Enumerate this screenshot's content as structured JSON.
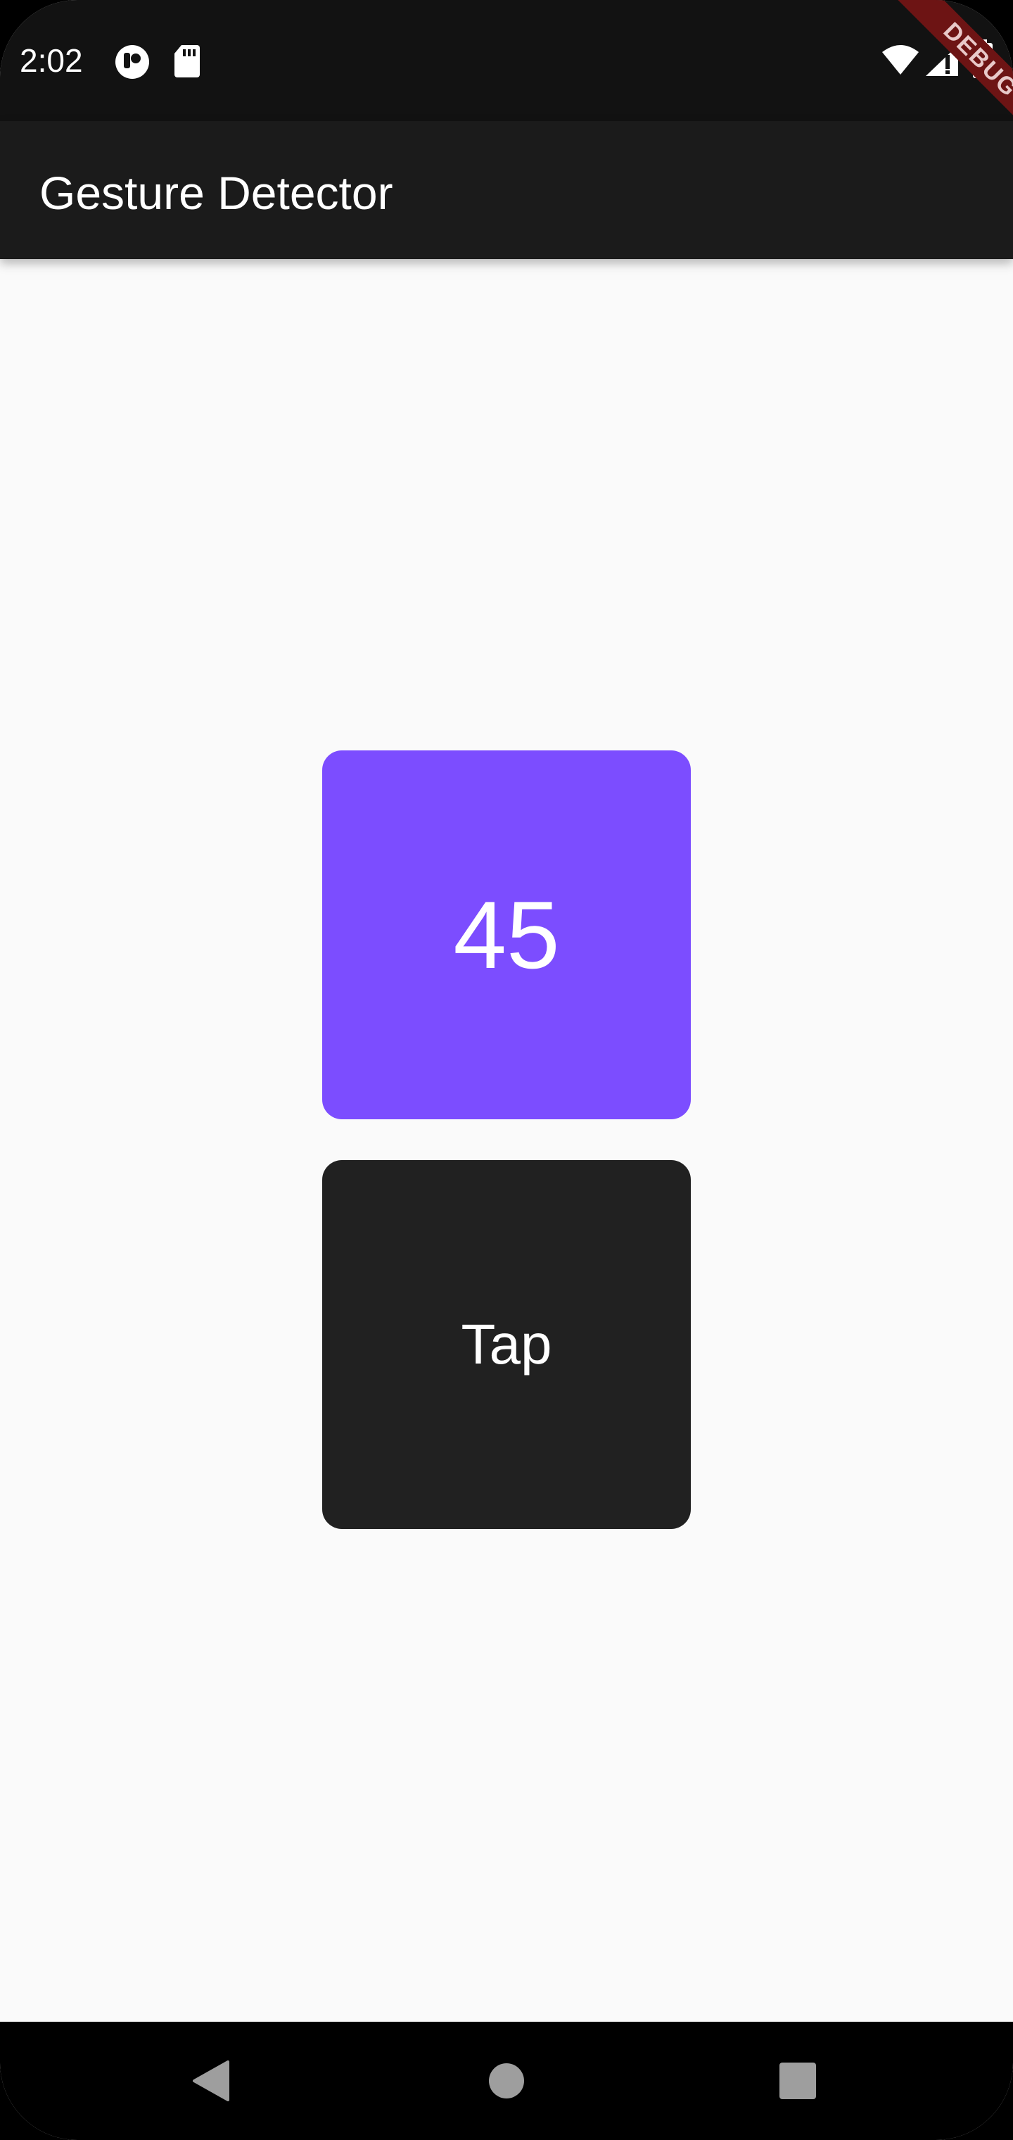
{
  "status_bar": {
    "time": "2:02",
    "left_icons": [
      "record-icon",
      "sd-card-icon"
    ],
    "right_icons": [
      "wifi-icon",
      "cell-signal-icon",
      "battery-icon"
    ]
  },
  "app_bar": {
    "title": "Gesture Detector"
  },
  "debug_banner": {
    "label": "DEBUG",
    "color": "#6d1414"
  },
  "counter": {
    "value": "45",
    "color": "#7c4dff"
  },
  "tap_button": {
    "label": "Tap",
    "color": "#212121"
  },
  "nav_bar": {
    "buttons": [
      "back-icon",
      "home-icon",
      "recents-icon"
    ]
  }
}
